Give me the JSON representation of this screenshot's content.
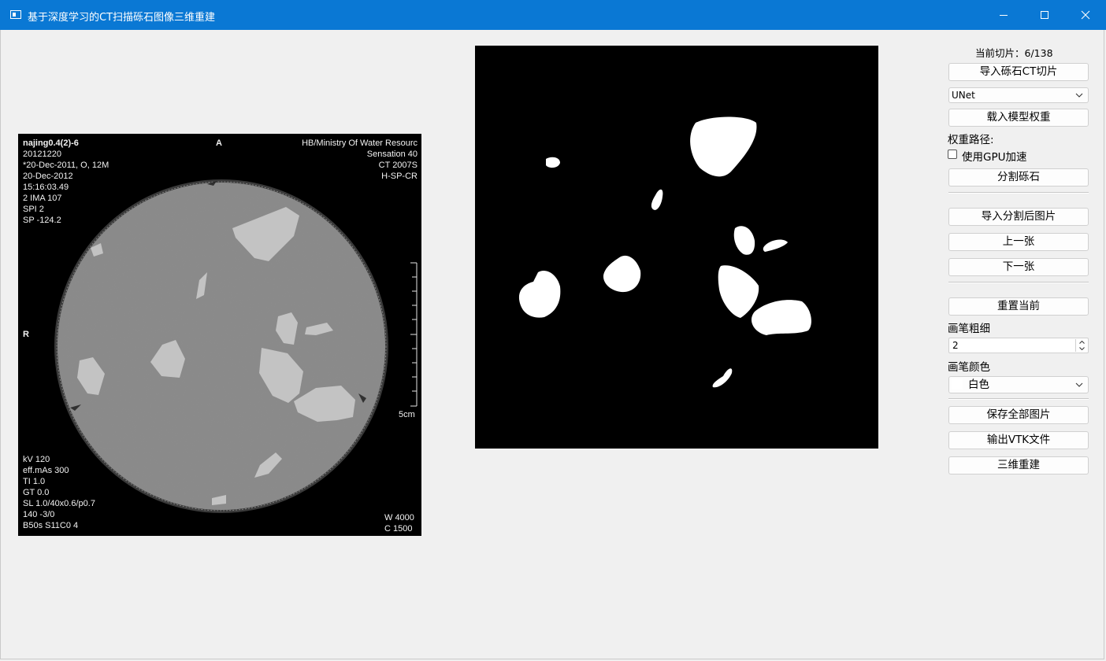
{
  "window": {
    "title": "基于深度学习的CT扫描砾石图像三维重建"
  },
  "ct_overlay": {
    "top_left": [
      "najing0.4(2)-6",
      "20121220",
      "*20-Dec-2011, O, 12M",
      "20-Dec-2012",
      "15:16:03.49",
      "2 IMA 107",
      "SPI 2",
      "SP -124.2"
    ],
    "top_center": "A",
    "top_right": [
      "HB/Ministry Of Water Resourc",
      "Sensation 40",
      "CT 2007S",
      "H-SP-CR"
    ],
    "left_marker": "R",
    "scale_label": "5cm",
    "bottom_left": [
      "kV 120",
      "eff.mAs 300",
      "TI 1.0",
      "GT 0.0",
      "SL 1.0/40x0.6/p0.7",
      "140 -3/0",
      "B50s S11C0  4"
    ],
    "bottom_right": [
      "W  4000",
      "C  1500"
    ]
  },
  "sidebar": {
    "slice_label": "当前切片：6/138",
    "import_ct_button": "导入砾石CT切片",
    "model_select": "UNet",
    "load_weights_button": "载入模型权重",
    "weights_path_label": "权重路径:",
    "gpu_checkbox_label": "使用GPU加速",
    "gpu_checked": false,
    "segment_button": "分割砾石",
    "import_segmented_button": "导入分割后图片",
    "prev_button": "上一张",
    "next_button": "下一张",
    "reset_button": "重置当前",
    "brush_size_label": "画笔粗细",
    "brush_size_value": "2",
    "brush_color_label": "画笔颜色",
    "brush_color_value": "白色",
    "brush_color_hex": "#ffffff",
    "save_all_button": "保存全部图片",
    "export_vtk_button": "输出VTK文件",
    "reconstruct_button": "三维重建"
  },
  "icons": {
    "app": "app-window-icon",
    "minimize": "minimize-icon",
    "maximize": "maximize-icon",
    "close": "close-icon",
    "dropdown": "chevron-down-icon"
  }
}
